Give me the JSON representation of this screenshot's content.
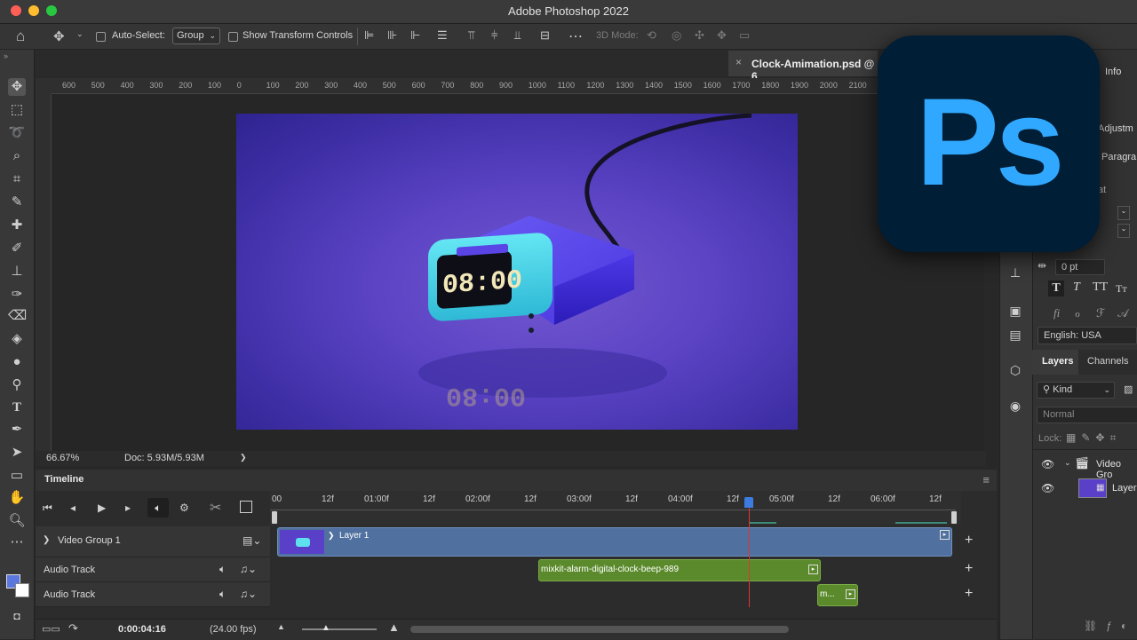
{
  "app": {
    "title": "Adobe Photoshop 2022"
  },
  "options_bar": {
    "auto_select_label": "Auto-Select:",
    "auto_select_value": "Group",
    "show_transform_label": "Show Transform Controls",
    "mode_3d_label": "3D Mode:"
  },
  "document": {
    "tab_title": "Clock-Amimation.psd @ 6",
    "close_glyph": "×"
  },
  "ruler": {
    "h_labels": [
      "600",
      "500",
      "400",
      "300",
      "200",
      "100",
      "0",
      "100",
      "200",
      "300",
      "400",
      "500",
      "600",
      "700",
      "800",
      "900",
      "1000",
      "1100",
      "1200",
      "1300",
      "1400",
      "1500",
      "1600",
      "1700",
      "1800",
      "1900",
      "2000",
      "2100"
    ]
  },
  "canvas": {
    "clock_digits": "08:00",
    "reflection_digits": "08:00"
  },
  "status": {
    "zoom": "66.67%",
    "doc_info": "Doc: 5.93M/5.93M",
    "arrow": "❯"
  },
  "timeline": {
    "title": "Timeline",
    "ruler_labels": [
      "00",
      "12f",
      "01:00f",
      "12f",
      "02:00f",
      "12f",
      "03:00f",
      "12f",
      "04:00f",
      "12f",
      "05:00f",
      "12f",
      "06:00f",
      "12f"
    ],
    "tracks": [
      {
        "label": "Video Group 1"
      },
      {
        "label": "Audio Track"
      },
      {
        "label": "Audio Track"
      }
    ],
    "clips": {
      "video": "Layer 1",
      "audio1": "mixkit-alarm-digital-clock-beep-989",
      "audio2": "m..."
    },
    "timecode": "0:00:04:16",
    "fps": "(24.00 fps)"
  },
  "right_panel": {
    "tab_info": "Info",
    "adjustments": "Adjustm",
    "paragraph": "Paragra",
    "format_partial": "at",
    "percent_partial": "%",
    "tracking_value": "0 pt",
    "language": "English: USA",
    "layers_tab": "Layers",
    "channels_tab": "Channels",
    "kind_filter": "Kind",
    "blend_mode": "Normal",
    "lock_label": "Lock:",
    "layer_items": [
      {
        "name": "Video Gro"
      },
      {
        "name": "Layer"
      }
    ]
  },
  "colors": {
    "accent": "#31a8ff",
    "logo_bg": "#001e36",
    "video_clip": "#50719f",
    "audio_clip": "#5b8a2c",
    "playhead": "#e03434"
  },
  "logo": {
    "text": "Ps"
  }
}
